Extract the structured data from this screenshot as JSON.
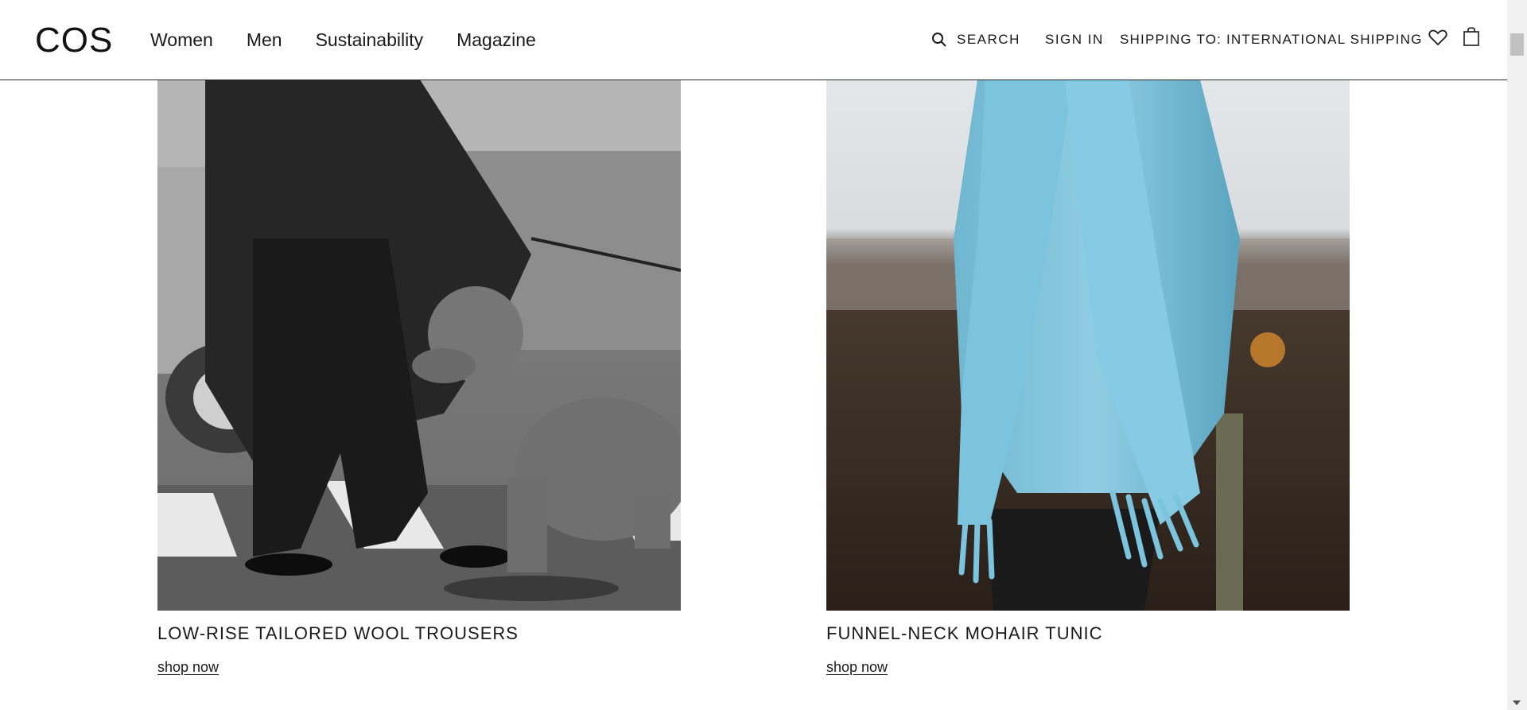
{
  "header": {
    "logo": "COS",
    "nav": [
      "Women",
      "Men",
      "Sustainability",
      "Magazine"
    ],
    "search_label": "SEARCH",
    "signin_label": "SIGN IN",
    "shipping_label": "SHIPPING TO: INTERNATIONAL SHIPPING"
  },
  "icons": {
    "search": "search-icon",
    "wishlist": "heart-icon",
    "bag": "shopping-bag-icon"
  },
  "products": [
    {
      "title": "LOW-RISE TAILORED WOOL TROUSERS",
      "cta": "shop now",
      "image": "black-and-white photo of a person in a dark coat and trousers walking a poodle across a crosswalk"
    },
    {
      "title": "FUNNEL-NECK MOHAIR TUNIC",
      "cta": "shop now",
      "image": "photo of a light blue mohair knit tunic with a fringed blue scarf"
    }
  ],
  "colors": {
    "text": "#1a1a1a",
    "background": "#ffffff",
    "accent_blue": "#7fc4dc"
  }
}
